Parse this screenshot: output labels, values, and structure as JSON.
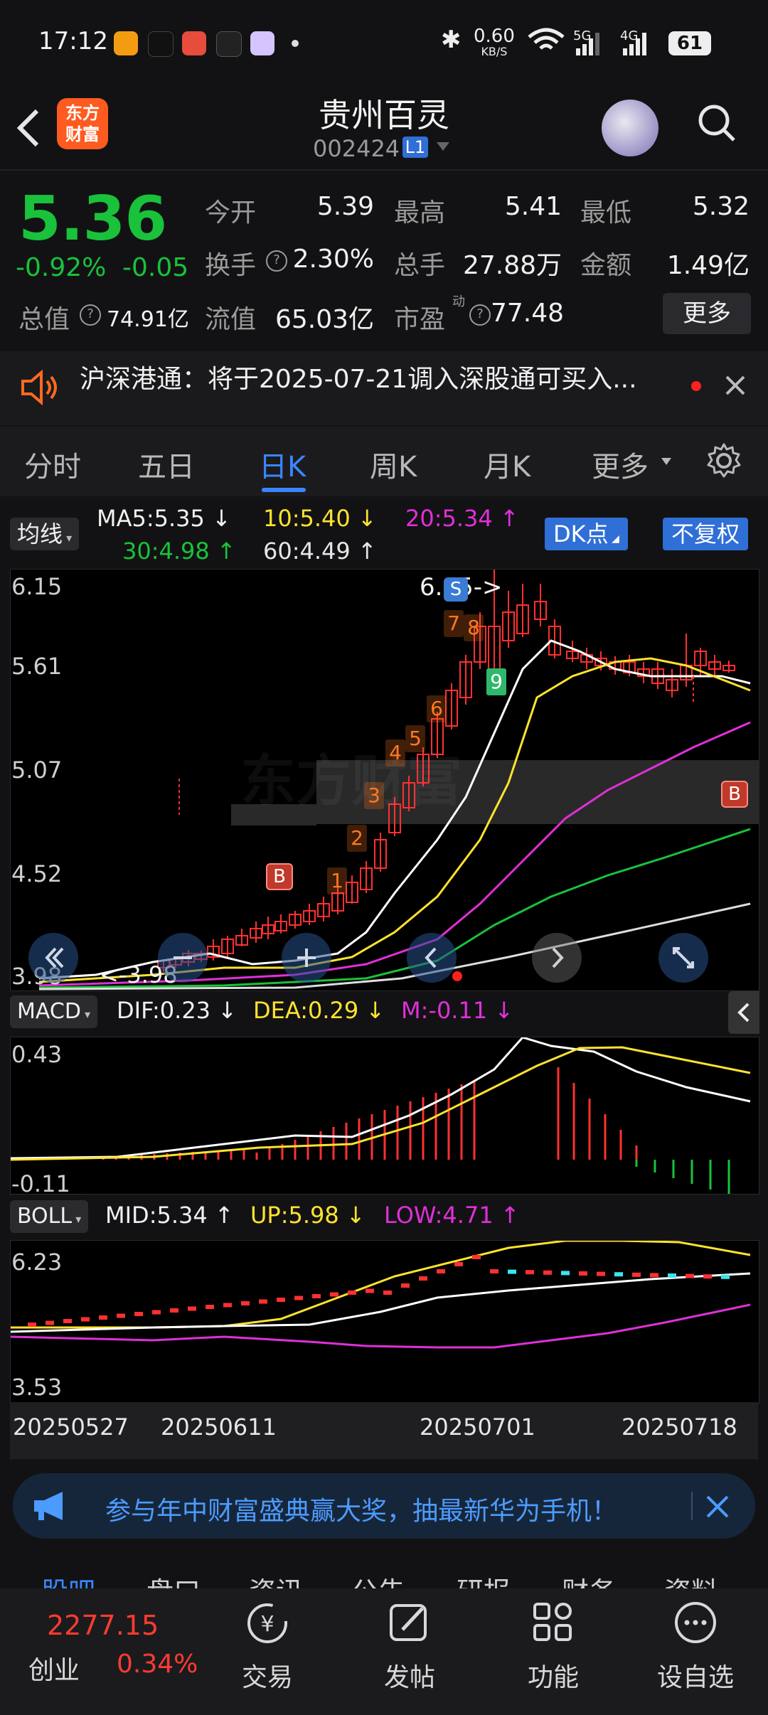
{
  "status_bar": {
    "time": "17:12",
    "net_speed": "0.60",
    "net_unit": "KB/S",
    "signal1": "5G",
    "signal2": "4G",
    "battery": "61"
  },
  "header": {
    "logo_text": "东方财富",
    "stock_name": "贵州百灵",
    "stock_code": "002424",
    "level_badge": "L1"
  },
  "quote": {
    "price": "5.36",
    "change_pct": "-0.92%",
    "change_abs": "-0.05",
    "total_value_label": "总值",
    "total_value": "74.91亿",
    "open_label": "今开",
    "open": "5.39",
    "high_label": "最高",
    "high": "5.41",
    "low_label": "最低",
    "low": "5.32",
    "turnover_label": "换手",
    "turnover": "2.30%",
    "volume_label": "总手",
    "volume": "27.88万",
    "amount_label": "金额",
    "amount": "1.49亿",
    "float_label": "流值",
    "float_value": "65.03亿",
    "pe_label": "市盈",
    "pe_superscript": "动",
    "pe": "77.48",
    "more_button": "更多",
    "up_color": "#ff3b30",
    "down_color": "#19c23a"
  },
  "notice": {
    "text": "沪深港通：将于2025-07-21调入深股通可买入..."
  },
  "tabs": [
    {
      "label": "分时"
    },
    {
      "label": "五日"
    },
    {
      "label": "日K"
    },
    {
      "label": "周K"
    },
    {
      "label": "月K"
    },
    {
      "label": "更多"
    }
  ],
  "ma_legend": {
    "selector": "均线",
    "ma5": "MA5:5.35",
    "ma10": "10:5.40",
    "ma20": "20:5.34",
    "ma30": "30:4.98",
    "ma60": "60:4.49",
    "dk_button": "DK点",
    "adj_button": "不复权"
  },
  "kline": {
    "y_labels": [
      "6.15",
      "5.61",
      "5.07",
      "4.52",
      "3.98"
    ],
    "high_marker": "6.15->",
    "low_marker": "<-3.98",
    "watermark": "东方财富",
    "signals": [
      "1",
      "2",
      "3",
      "4",
      "5",
      "6",
      "7",
      "8",
      "9"
    ],
    "buy_mark": "B",
    "sell_mark": "S"
  },
  "macd": {
    "selector": "MACD",
    "dif": "DIF:0.23",
    "dea": "DEA:0.29",
    "m": "M:-0.11",
    "y_top": "0.43",
    "y_bottom": "-0.11"
  },
  "boll": {
    "selector": "BOLL",
    "mid": "MID:5.34",
    "up": "UP:5.98",
    "low": "LOW:4.71",
    "y_top": "6.23",
    "y_bottom": "3.53"
  },
  "dates": [
    "20250527",
    "20250611",
    "20250701",
    "20250718"
  ],
  "ad": {
    "text": "参与年中财富盛典赢大奖，抽最新华为手机！"
  },
  "subtabs": [
    "股吧",
    "盘口",
    "资讯",
    "公告",
    "研报",
    "财务",
    "资料"
  ],
  "bottom_nav": {
    "index_value": "2277.15",
    "index_name": "创业",
    "index_change": "0.34%",
    "items": [
      {
        "label": "交易",
        "icon": "trade-icon"
      },
      {
        "label": "发帖",
        "icon": "edit-icon"
      },
      {
        "label": "功能",
        "icon": "grid-icon"
      },
      {
        "label": "设自选",
        "icon": "more-icon"
      }
    ]
  }
}
